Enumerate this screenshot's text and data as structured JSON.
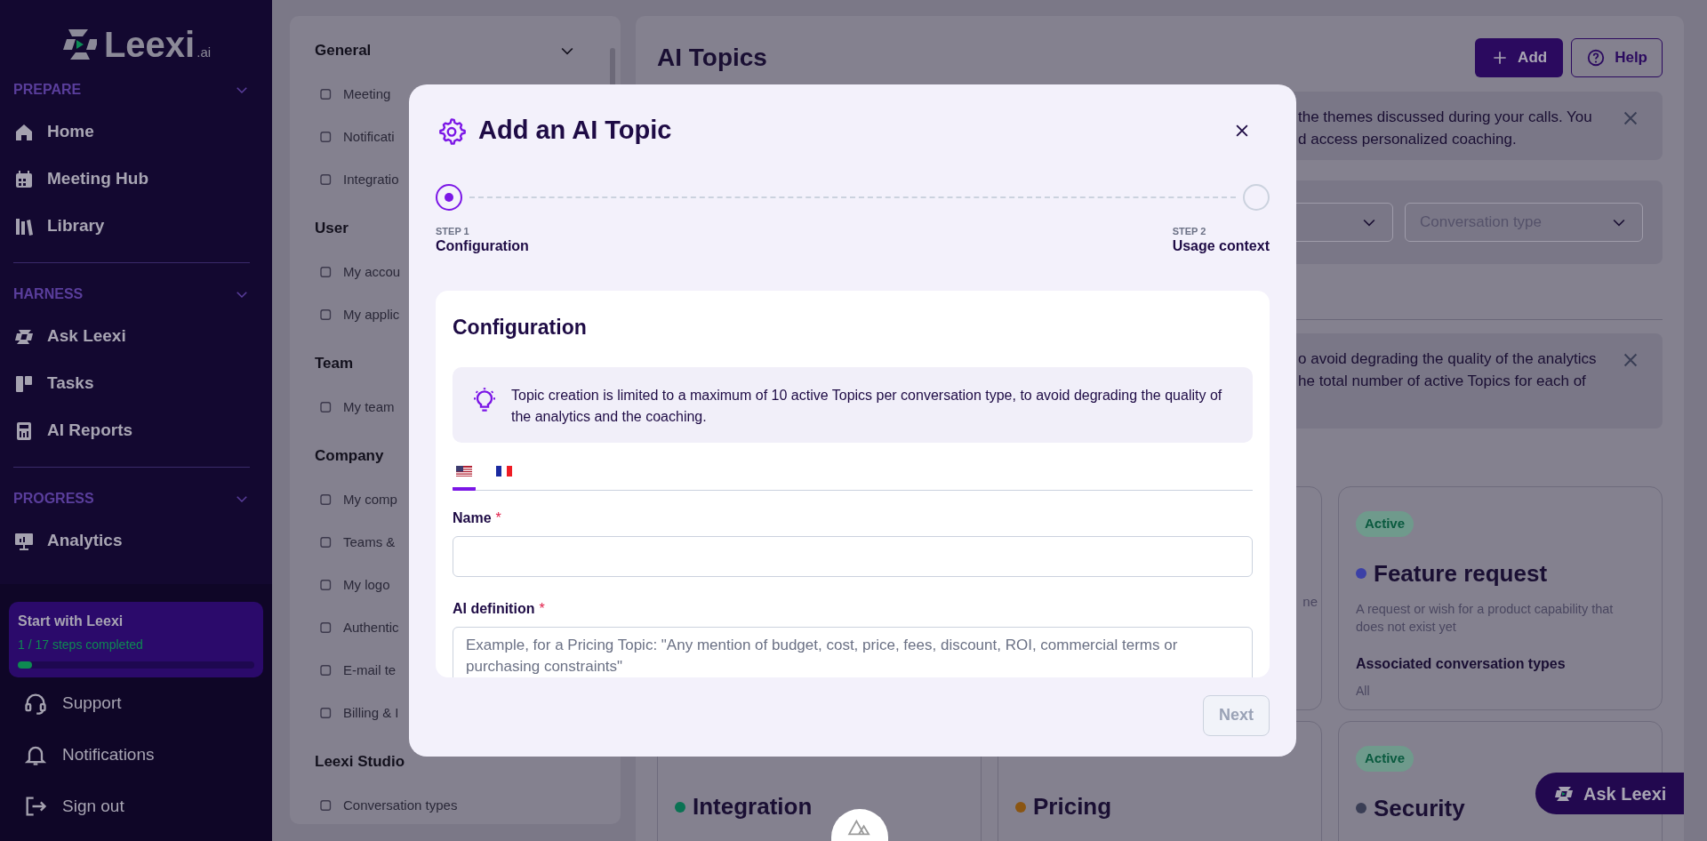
{
  "sidebar": {
    "logo": {
      "text": "Leexi",
      "suffix": ".ai"
    },
    "sections": [
      {
        "title": "PREPARE",
        "expanded": true,
        "items": [
          "Home",
          "Meeting Hub",
          "Library"
        ]
      },
      {
        "title": "HARNESS",
        "expanded": true,
        "items": [
          "Ask Leexi",
          "Tasks",
          "AI Reports"
        ]
      },
      {
        "title": "PROGRESS",
        "expanded": true,
        "items": [
          "Analytics"
        ]
      }
    ],
    "onboarding": {
      "title": "Start with Leexi",
      "progress": "1 / 17 steps completed",
      "level": 0.06
    },
    "footer": [
      "Support",
      "Notifications",
      "Sign out"
    ]
  },
  "settings_nav": {
    "groups": [
      {
        "title": "General",
        "collapsible": true,
        "items": [
          "Meeting",
          "Notificati",
          "Integratio"
        ]
      },
      {
        "title": "User",
        "collapsible": false,
        "items": [
          "My accou",
          "My applic"
        ]
      },
      {
        "title": "Team",
        "collapsible": false,
        "items": [
          "My team"
        ]
      },
      {
        "title": "Company",
        "collapsible": false,
        "items": [
          "My comp",
          "Teams &",
          "My logo",
          "Authentic",
          "E-mail te",
          "Billing & I"
        ]
      },
      {
        "title": "Leexi Studio",
        "collapsible": false,
        "items": [
          "Conversation types"
        ]
      }
    ]
  },
  "main": {
    "title": "AI Topics",
    "buttons": [
      {
        "label": "Add",
        "kind": "primary"
      },
      {
        "label": "Help",
        "kind": "outline"
      }
    ],
    "banners": [
      {
        "lines": [
          "the themes discussed during your calls. You",
          "d access personalized coaching."
        ]
      },
      {
        "lines": [
          "o avoid degrading the quality of the analytics",
          "he total number of active Topics for each of"
        ]
      }
    ],
    "filters": [
      {
        "placeholder": "Conversation type"
      }
    ],
    "card_fragment": "ne",
    "topic_cards": [
      {
        "status": "Active",
        "title": "Feature request",
        "color": "#3b40a6",
        "description": "A request or wish for a product capability that does not exist yet",
        "types_heading": "Associated conversation types",
        "types": "All"
      },
      {
        "title": "Integration",
        "color": "#0a7253"
      },
      {
        "title": "Pricing",
        "color": "#8a5512"
      },
      {
        "status": "Active",
        "title": "Security",
        "color": "#3a3e55"
      }
    ]
  },
  "ask_button": {
    "label": "Ask Leexi"
  },
  "modal": {
    "title": "Add an AI Topic",
    "steps": [
      {
        "number": "STEP 1",
        "label": "Configuration",
        "active": true
      },
      {
        "number": "STEP 2",
        "label": "Usage context",
        "active": false
      }
    ],
    "section_title": "Configuration",
    "notice": "Topic creation is limited to a maximum of 10 active Topics per conversation type, to avoid degrading the quality of the analytics and the coaching.",
    "language_tabs": [
      {
        "kind": "us",
        "selected": true
      },
      {
        "kind": "fr",
        "selected": false
      }
    ],
    "fields": [
      {
        "kind": "input",
        "label": "Name",
        "required_mark": "*"
      },
      {
        "kind": "textarea",
        "label": "AI definition",
        "required_mark": "*",
        "placeholder": "Example, for a Pricing Topic: \"Any mention of budget, cost, price, fees, discount, ROI, commercial terms or purchasing constraints\""
      }
    ],
    "next_button": {
      "label": "Next",
      "disabled": true
    }
  }
}
